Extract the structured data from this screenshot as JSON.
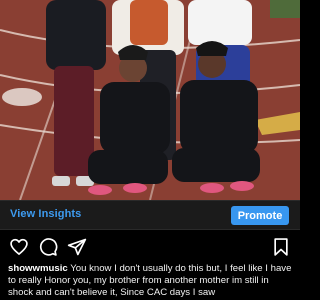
{
  "post": {
    "photo_alt": "",
    "insights_label": "View Insights",
    "promote_label": "Promote",
    "actions": {
      "like_icon": "heart-icon",
      "comment_icon": "comment-icon",
      "share_icon": "paper-plane-icon",
      "save_icon": "bookmark-icon"
    },
    "caption": {
      "username": "showwmusic",
      "text": "You know I don't usually do this but, I feel like I have to really Honor you, my brother from another mother im still in shock and can't believe it, Since CAC days I saw"
    }
  },
  "colors": {
    "background": "#000000",
    "link_blue": "#3d9bf0",
    "button_blue": "#3897f0",
    "text": "#ffffff"
  }
}
